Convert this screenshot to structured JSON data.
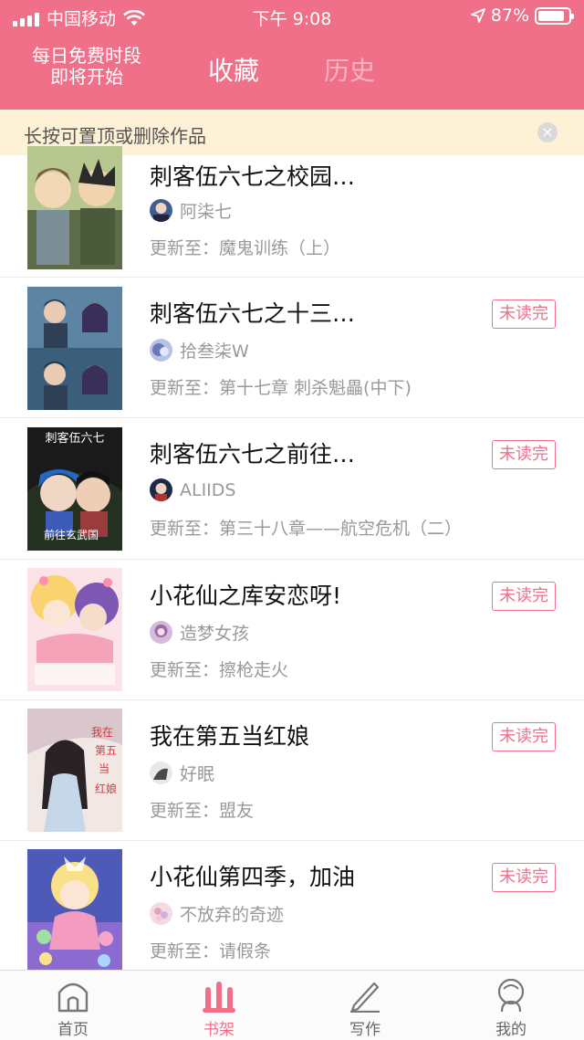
{
  "status_bar": {
    "carrier": "中国移动",
    "time": "下午 9:08",
    "battery": "87%",
    "battery_level": 0.87
  },
  "header": {
    "promo_line1": "每日免费时段",
    "promo_line2": "即将开始",
    "tab_favorites": "收藏",
    "tab_history": "历史"
  },
  "hint": {
    "text": "长按可置顶或删除作品",
    "close": "×"
  },
  "items": [
    {
      "title": "刺客伍六七之校园…",
      "author": "阿柒七",
      "update": "更新至：魔鬼训练（上）",
      "unread": ""
    },
    {
      "title": "刺客伍六七之十三…",
      "author": "拾叁柒W",
      "update": "更新至：第十七章 刺杀魁畾(中下)",
      "unread": "未读完"
    },
    {
      "title": "刺客伍六七之前往…",
      "author": "ALIIDS",
      "update": "更新至：第三十八章——航空危机（二）",
      "unread": "未读完"
    },
    {
      "title": "小花仙之库安恋呀!",
      "author": "造梦女孩",
      "update": "更新至：擦枪走火",
      "unread": "未读完"
    },
    {
      "title": "我在第五当红娘",
      "author": "好眠",
      "update": "更新至：盟友",
      "unread": "未读完"
    },
    {
      "title": "小花仙第四季，加油",
      "author": "不放弃的奇迹",
      "update": "更新至：请假条",
      "unread": "未读完"
    }
  ],
  "covers": {
    "cover3_text1": "刺客伍六七",
    "cover3_text2": "前往玄武国"
  },
  "nav": {
    "home": "首页",
    "shelf": "书架",
    "write": "写作",
    "mine": "我的"
  },
  "colors": {
    "accent": "#f07089",
    "hint_bg": "#fdf1d6"
  }
}
